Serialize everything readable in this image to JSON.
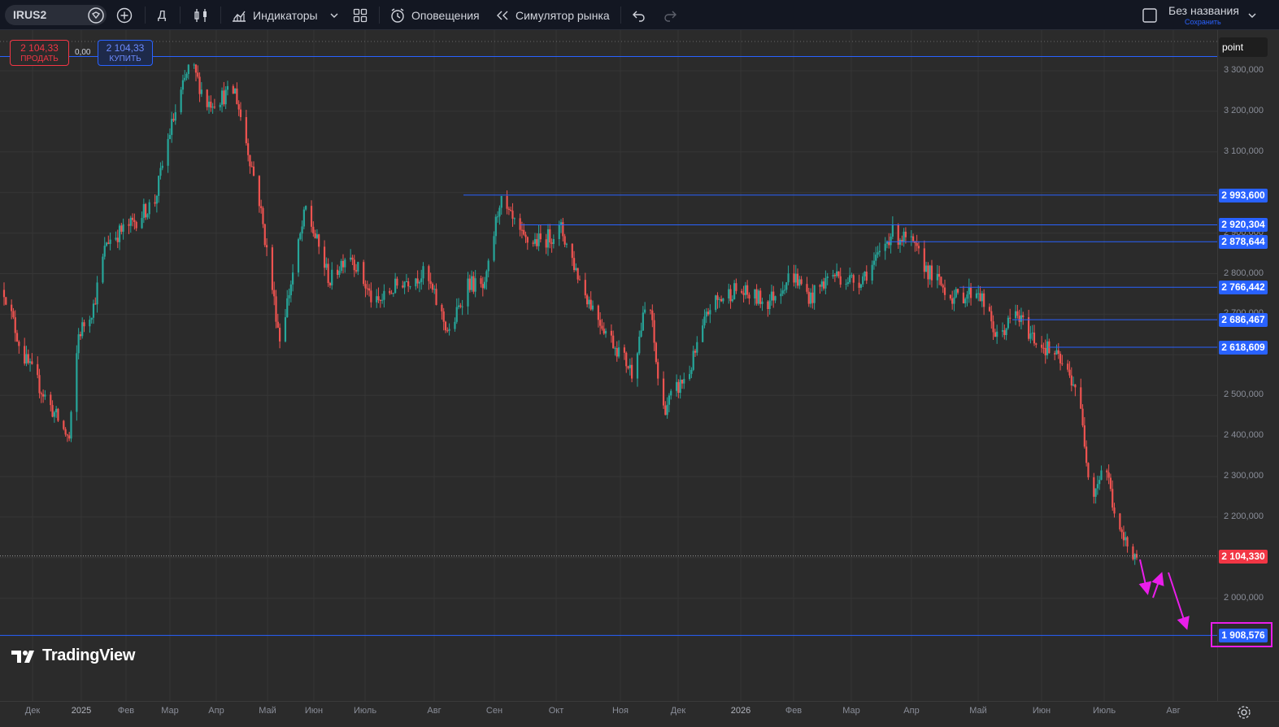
{
  "toolbar": {
    "symbol": "IRUS2",
    "interval": "Д",
    "indicators_label": "Индикаторы",
    "alerts_label": "Оповещения",
    "replay_label": "Симулятор рынка",
    "layout_name": "Без названия",
    "layout_save": "Сохранить"
  },
  "trade": {
    "sell_price": "2 104,33",
    "sell_label": "ПРОДАТЬ",
    "spread": "0,00",
    "buy_price": "2 104,33",
    "buy_label": "КУПИТЬ"
  },
  "scale_unit": "point",
  "watermark": "TradingView",
  "colors": {
    "up": "#26a69a",
    "down": "#ef5350",
    "hline": "#2962ff",
    "arrow": "#e91eea",
    "current_price": "#f23645",
    "background": "#2b2b2b"
  },
  "price_axis_labels": [
    "3 300,000",
    "3 200,000",
    "3 100,000",
    "2 900,000",
    "2 800,000",
    "2 700,000",
    "2 500,000",
    "2 400,000",
    "2 300,000",
    "2 200,000",
    "2 000,000"
  ],
  "time_axis_labels": [
    "Дек",
    "2025",
    "Фев",
    "Мар",
    "Апр",
    "Май",
    "Июн",
    "Июль",
    "Авг",
    "Сен",
    "Окт",
    "Ноя",
    "Дек",
    "2026",
    "Фев",
    "Мар",
    "Апр",
    "Май",
    "Июн",
    "Июль",
    "Авг"
  ],
  "horizontal_levels": [
    {
      "label": "2 993,600",
      "value": 2993.6
    },
    {
      "label": "2 920,304",
      "value": 2920.304
    },
    {
      "label": "2 878,644",
      "value": 2878.644
    },
    {
      "label": "2 766,442",
      "value": 2766.442
    },
    {
      "label": "2 686,467",
      "value": 2686.467
    },
    {
      "label": "2 618,609",
      "value": 2618.609
    },
    {
      "label": "1 908,576",
      "value": 1908.576
    }
  ],
  "current_price": {
    "label": "2 104,330",
    "value": 2104.33
  },
  "top_level_value": 3335,
  "chart_data": {
    "type": "candlestick",
    "x_start": "2024-11-21",
    "x_end": "2026-07-22",
    "y_range": [
      1850,
      3380
    ],
    "anchor_closes": [
      [
        "2024-11-21",
        2760
      ],
      [
        "2024-12-01",
        2600
      ],
      [
        "2024-12-15",
        2480
      ],
      [
        "2024-12-26",
        2390
      ],
      [
        "2024-12-31",
        2650
      ],
      [
        "2025-01-08",
        2720
      ],
      [
        "2025-01-15",
        2880
      ],
      [
        "2025-01-28",
        2920
      ],
      [
        "2025-02-10",
        2980
      ],
      [
        "2025-02-18",
        3150
      ],
      [
        "2025-03-01",
        3320
      ],
      [
        "2025-03-10",
        3220
      ],
      [
        "2025-03-25",
        3250
      ],
      [
        "2025-04-07",
        2980
      ],
      [
        "2025-04-18",
        2640
      ],
      [
        "2025-05-02",
        2960
      ],
      [
        "2025-05-15",
        2780
      ],
      [
        "2025-05-25",
        2860
      ],
      [
        "2025-06-08",
        2720
      ],
      [
        "2025-06-22",
        2780
      ],
      [
        "2025-07-05",
        2800
      ],
      [
        "2025-07-18",
        2650
      ],
      [
        "2025-07-28",
        2780
      ],
      [
        "2025-08-06",
        2760
      ],
      [
        "2025-08-14",
        2980
      ],
      [
        "2025-08-27",
        2880
      ],
      [
        "2025-09-06",
        2880
      ],
      [
        "2025-09-16",
        2910
      ],
      [
        "2025-09-28",
        2760
      ],
      [
        "2025-10-10",
        2660
      ],
      [
        "2025-10-24",
        2560
      ],
      [
        "2025-11-02",
        2750
      ],
      [
        "2025-11-09",
        2460
      ],
      [
        "2025-11-24",
        2560
      ],
      [
        "2025-12-05",
        2720
      ],
      [
        "2025-12-18",
        2760
      ],
      [
        "2026-01-05",
        2730
      ],
      [
        "2026-01-18",
        2800
      ],
      [
        "2026-01-28",
        2740
      ],
      [
        "2026-02-08",
        2800
      ],
      [
        "2026-02-22",
        2780
      ],
      [
        "2026-03-04",
        2830
      ],
      [
        "2026-03-12",
        2900
      ],
      [
        "2026-03-22",
        2880
      ],
      [
        "2026-04-02",
        2800
      ],
      [
        "2026-04-15",
        2740
      ],
      [
        "2026-04-28",
        2760
      ],
      [
        "2026-05-08",
        2640
      ],
      [
        "2026-05-18",
        2700
      ],
      [
        "2026-05-28",
        2640
      ],
      [
        "2026-06-08",
        2600
      ],
      [
        "2026-06-20",
        2520
      ],
      [
        "2026-06-28",
        2250
      ],
      [
        "2026-07-05",
        2340
      ],
      [
        "2026-07-12",
        2160
      ],
      [
        "2026-07-22",
        2104
      ]
    ]
  }
}
